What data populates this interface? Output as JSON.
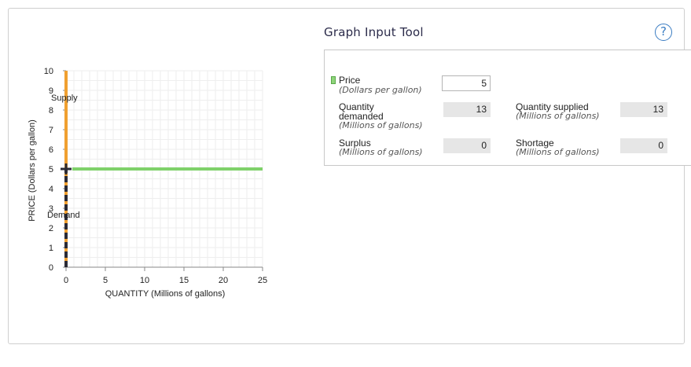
{
  "graph": {
    "y_axis_label": "PRICE (Dollars per gallon)",
    "x_axis_label": "QUANTITY (Millions of gallons)",
    "y_ticks": [
      0,
      1,
      2,
      3,
      4,
      5,
      6,
      7,
      8,
      9,
      10
    ],
    "x_ticks": [
      0,
      5,
      10,
      15,
      20,
      25
    ],
    "supply_label": "Supply",
    "demand_label": "Demand",
    "colors": {
      "supply": "#f0a030",
      "demand": "#2b2b35",
      "price_line": "#7fd16a",
      "grid": "#eeeeee"
    }
  },
  "chart_data": {
    "type": "line",
    "xlabel": "QUANTITY (Millions of gallons)",
    "ylabel": "PRICE (Dollars per gallon)",
    "xlim": [
      0,
      25
    ],
    "ylim": [
      0,
      10
    ],
    "grid": true,
    "series": [
      {
        "name": "Supply",
        "x": [
          0,
          0
        ],
        "y": [
          0,
          10
        ]
      },
      {
        "name": "Demand",
        "x": [
          0,
          0
        ],
        "y": [
          0,
          10
        ]
      },
      {
        "name": "Price",
        "x": [
          0,
          25
        ],
        "y": [
          5,
          5
        ]
      }
    ],
    "annotations": [
      {
        "text": "+",
        "x": 0,
        "y": 5
      }
    ]
  },
  "tool": {
    "title": "Graph Input Tool",
    "help_icon": "question-circle-icon",
    "price_label": "Price",
    "price_unit": "(Dollars per gallon)",
    "price_value": "5",
    "qd_label_line1": "Quantity",
    "qd_label_line2": "demanded",
    "qd_unit": "(Millions of gallons)",
    "qd_value": "13",
    "qs_label": "Quantity supplied",
    "qs_unit": "(Millions of gallons)",
    "qs_value": "13",
    "surplus_label": "Surplus",
    "surplus_unit": "(Millions of gallons)",
    "surplus_value": "0",
    "shortage_label": "Shortage",
    "shortage_unit": "(Millions of gallons)",
    "shortage_value": "0"
  }
}
